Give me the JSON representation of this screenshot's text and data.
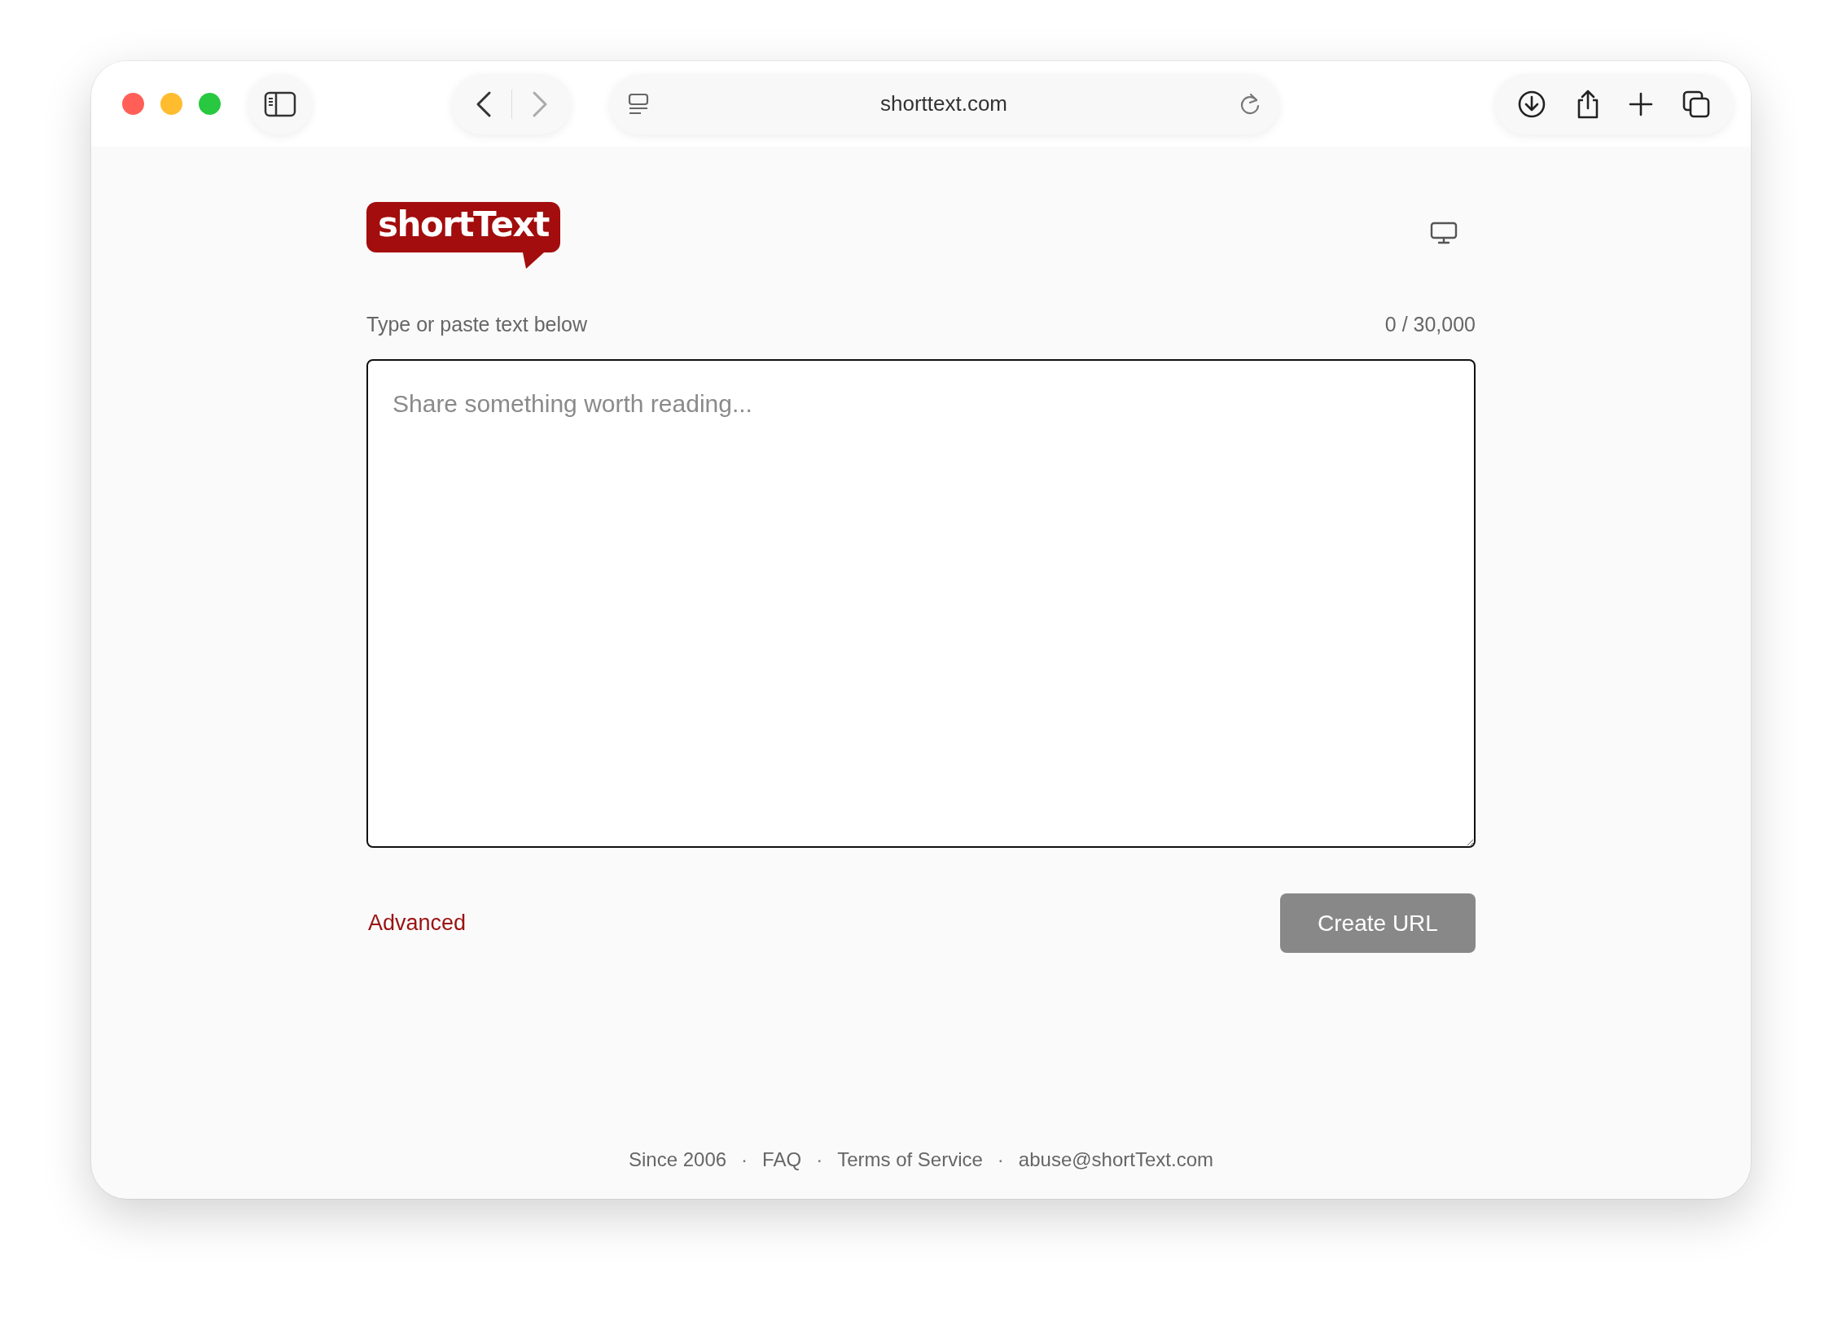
{
  "browser": {
    "url": "shorttext.com",
    "back_disabled": false,
    "forward_disabled": true
  },
  "logo": {
    "text": "shortText"
  },
  "editor": {
    "label": "Type or paste text below",
    "counter": "0 / 30,000",
    "placeholder": "Share something worth reading..."
  },
  "advanced_link": "Advanced",
  "create_button": {
    "label": "Create URL",
    "disabled": true
  },
  "footer": [
    {
      "kind": "item",
      "text": "Since 2006"
    },
    {
      "kind": "separator",
      "text": "·"
    },
    {
      "kind": "item",
      "text": "FAQ"
    },
    {
      "kind": "separator",
      "text": "·"
    },
    {
      "kind": "item",
      "text": "Terms of Service"
    },
    {
      "kind": "separator",
      "text": "·"
    },
    {
      "kind": "item",
      "text": "abuse@shortText.com"
    }
  ]
}
